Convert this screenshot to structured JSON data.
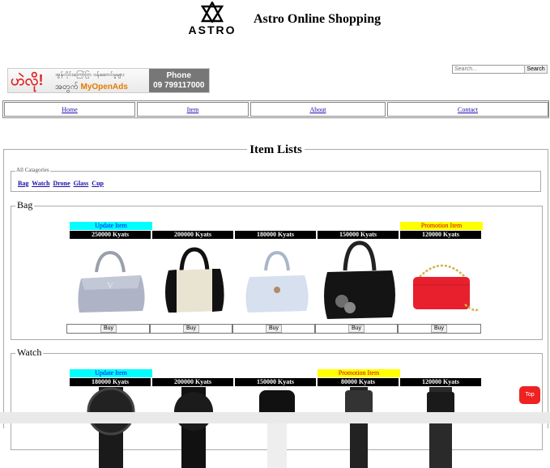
{
  "header": {
    "logo_text": "ASTRO",
    "site_title": "Astro Online Shopping"
  },
  "ad": {
    "big_text": "ဟဲလို!",
    "line1": "အွန်လိုင်းကြော်ငြာ ဝန်ဆောင်မှုများ",
    "line2_prefix": "အတွက်",
    "brand": "MyOpenAds",
    "phone_label": "Phone",
    "phone_number": "09 799117000"
  },
  "search": {
    "placeholder": "Search...",
    "button_label": "Search"
  },
  "nav": [
    "Home",
    "Item",
    "About",
    "Contact"
  ],
  "item_lists": {
    "title": "Item Lists",
    "categories_legend": "All Catagories",
    "categories": [
      "Bag",
      "Watch",
      "Drone",
      "Glass",
      "Cup"
    ]
  },
  "sections": [
    {
      "title": "Bag",
      "products": [
        {
          "tag": "Update Item",
          "tag_type": "update",
          "price": "250000 Kyats",
          "image": "lavender-handbag",
          "buy": "Buy"
        },
        {
          "tag": "",
          "tag_type": "",
          "price": "200000 Kyats",
          "image": "beige-tote-bag",
          "buy": "Buy"
        },
        {
          "tag": "",
          "tag_type": "",
          "price": "180000 Kyats",
          "image": "light-blue-handbag",
          "buy": "Buy"
        },
        {
          "tag": "",
          "tag_type": "",
          "price": "150000 Kyats",
          "image": "black-handbag",
          "buy": "Buy"
        },
        {
          "tag": "Promotion Item",
          "tag_type": "promo",
          "price": "120000 Kyats",
          "image": "red-chain-bag",
          "buy": "Buy"
        }
      ]
    },
    {
      "title": "Watch",
      "products": [
        {
          "tag": "Update Item",
          "tag_type": "update",
          "price": "180000 Kyats",
          "image": "sport-watch"
        },
        {
          "tag": "",
          "tag_type": "",
          "price": "200000 Kyats",
          "image": "black-watch"
        },
        {
          "tag": "",
          "tag_type": "",
          "price": "150000 Kyats",
          "image": "smart-watch"
        },
        {
          "tag": "Promotion Item",
          "tag_type": "promo",
          "price": "80000 Kyats",
          "image": "square-watch"
        },
        {
          "tag": "",
          "tag_type": "",
          "price": "120000 Kyats",
          "image": "mesh-watch"
        }
      ]
    }
  ],
  "top_button": "Top"
}
